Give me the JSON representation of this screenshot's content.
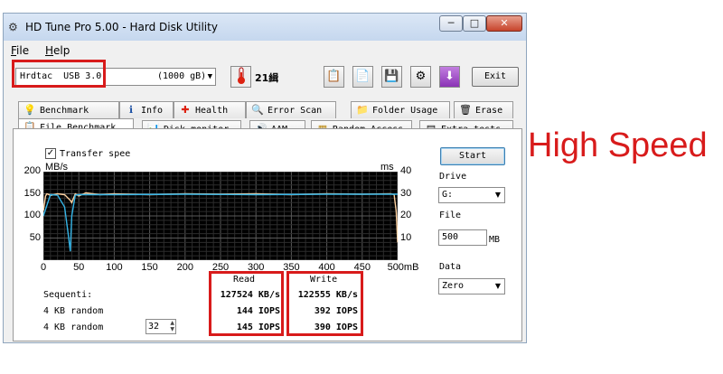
{
  "window": {
    "title": "HD Tune Pro 5.00 - Hard Disk Utility",
    "app_icon": "hdtune-icon"
  },
  "menu": [
    {
      "accel": "F",
      "rest": "ile"
    },
    {
      "accel": "H",
      "rest": "elp"
    }
  ],
  "toolbar": {
    "drive_name": "Hrdtac  USB 3.0",
    "drive_size": "(1000 gB)",
    "temperature": "21緝",
    "exit_label": "Exit",
    "icons": [
      "copy-icon",
      "copy-info-icon",
      "save-icon",
      "options-icon",
      "download-icon"
    ]
  },
  "tabs_top": [
    {
      "label": "Benchmark",
      "icon": "💡"
    },
    {
      "label": "Info",
      "icon": "ℹ"
    },
    {
      "label": "Health",
      "icon": "✚"
    },
    {
      "label": "Error Scan",
      "icon": "🔍"
    },
    {
      "label": "Folder Usage",
      "icon": "📁"
    },
    {
      "label": "Erase",
      "icon": "🗑"
    }
  ],
  "tabs_bottom": [
    {
      "label": "File Benchmark",
      "icon": "📋"
    },
    {
      "label": "Disk monitor",
      "icon": "📊"
    },
    {
      "label": "AAM",
      "icon": "🔊"
    },
    {
      "label": "Random Access",
      "icon": "▦"
    },
    {
      "label": "Extra tests",
      "icon": "▤"
    }
  ],
  "benchmark": {
    "transfer_checkbox": "Transfer spee",
    "left_unit": "MB/s",
    "right_unit": "ms",
    "col_read": "Read",
    "col_write": "Write",
    "rows": [
      {
        "label": "Sequenti:",
        "read": "127524 KB/s",
        "write": "122555 KB/s"
      },
      {
        "label": "4 KB random",
        "read": "144 IOPS",
        "write": "392 IOPS"
      },
      {
        "label": "4 KB random",
        "read": "145 IOPS",
        "write": "390 IOPS"
      }
    ],
    "queue_depth": "32"
  },
  "side": {
    "start_label": "Start",
    "drive_label": "Drive",
    "drive_value": "G:",
    "file_label": "File",
    "file_value": "500",
    "file_unit": "MB",
    "data_label": "Data",
    "data_value": "Zero"
  },
  "annotation": {
    "text": "High Speed",
    "color": "#d81b1b"
  },
  "chart_data": {
    "type": "line",
    "xlabel": "",
    "ylabel": "MB/s",
    "y2label": "ms",
    "x_ticks": [
      "0",
      "50",
      "100",
      "150",
      "200",
      "250",
      "300",
      "350",
      "400",
      "450",
      "500mB"
    ],
    "xlim": [
      0,
      500
    ],
    "y_ticks": [
      "50",
      "100",
      "150",
      "200"
    ],
    "ylim": [
      0,
      200
    ],
    "y2_ticks": [
      "10",
      "20",
      "30",
      "40"
    ],
    "y2lim": [
      0,
      40
    ],
    "grid": true,
    "background": "#000000",
    "series": [
      {
        "color": "#ffd2a0",
        "x": [
          0,
          3,
          5,
          8,
          10,
          20,
          30,
          38,
          40,
          45,
          50,
          60,
          80,
          100,
          150,
          200,
          250,
          300,
          350,
          400,
          450,
          490,
          495,
          498,
          500
        ],
        "values": [
          112,
          145,
          150,
          148,
          146,
          150,
          148,
          135,
          130,
          150,
          145,
          152,
          148,
          150,
          148,
          150,
          149,
          150,
          148,
          150,
          149,
          150,
          148,
          110,
          40
        ]
      },
      {
        "color": "#34b4e6",
        "x": [
          0,
          10,
          20,
          30,
          35,
          38,
          40,
          45,
          50,
          60,
          100,
          200,
          300,
          400,
          500
        ],
        "values": [
          100,
          148,
          147,
          120,
          60,
          20,
          100,
          147,
          148,
          148,
          148,
          149,
          148,
          149,
          149
        ]
      }
    ]
  }
}
